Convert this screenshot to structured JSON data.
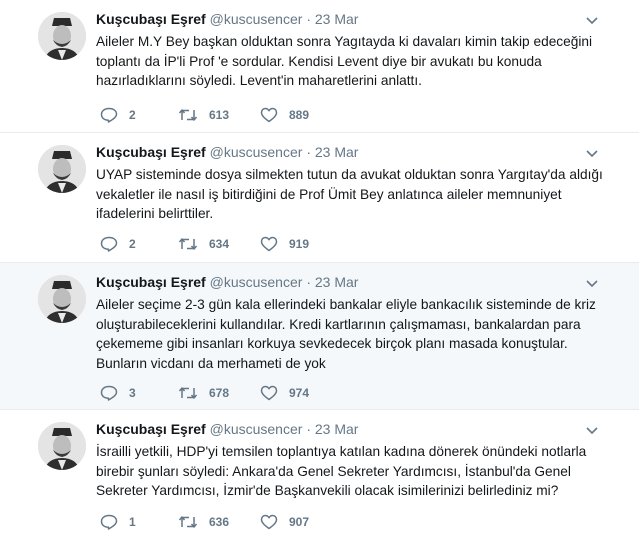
{
  "tweets": [
    {
      "author_name": "Kuşcubaşı Eşref",
      "handle": "@kuscusencer",
      "separator": "·",
      "date": "23 Mar",
      "text": "Aileler M.Y Bey başkan olduktan sonra Yagıtayda ki davaları kimin takip edeceğini toplantı da İP'li Prof 'e sordular. Kendisi Levent diye bir avukatı bu konuda hazırladıklarını söyledi. Levent'in maharetlerini anlattı.",
      "replies": "2",
      "retweets": "613",
      "likes": "889",
      "highlighted": false
    },
    {
      "author_name": "Kuşcubaşı Eşref",
      "handle": "@kuscusencer",
      "separator": "·",
      "date": "23 Mar",
      "text": "UYAP sisteminde dosya silmekten tutun da avukat olduktan sonra Yargıtay'da aldığı vekaletler ile nasıl iş bitirdiğini de Prof Ümit Bey anlatınca aileler memnuniyet ifadelerini belirttiler.",
      "replies": "2",
      "retweets": "634",
      "likes": "919",
      "highlighted": false
    },
    {
      "author_name": "Kuşcubaşı Eşref",
      "handle": "@kuscusencer",
      "separator": "·",
      "date": "23 Mar",
      "text": "Aileler seçime 2-3 gün kala ellerindeki bankalar eliyle bankacılık sisteminde de kriz oluşturabileceklerini kullandılar. Kredi kartlarının çalışmaması, bankalardan para çekememe gibi insanları korkuya sevkedecek birçok planı masada konuştular. Bunların vicdanı da merhameti de yok",
      "replies": "3",
      "retweets": "678",
      "likes": "974",
      "highlighted": true
    },
    {
      "author_name": "Kuşcubaşı Eşref",
      "handle": "@kuscusencer",
      "separator": "·",
      "date": "23 Mar",
      "text": "İsrailli yetkili, HDP'yi temsilen toplantıya katılan kadına dönerek önündeki notlarla birebir şunları söyledi: Ankara'da Genel Sekreter Yardımcısı, İstanbul'da Genel Sekreter Yardımcısı, İzmir'de Başkanvekili olacak isimilerinizi belirlediniz mi?",
      "replies": "1",
      "retweets": "636",
      "likes": "907",
      "highlighted": false
    }
  ],
  "icons": {
    "reply": "reply-icon",
    "retweet": "retweet-icon",
    "like": "heart-icon",
    "caret": "chevron-down-icon",
    "avatar": "avatar"
  },
  "colors": {
    "text": "#14171a",
    "muted": "#657786",
    "highlight_bg": "#f5f8fa",
    "divider": "#e6ecf0"
  }
}
